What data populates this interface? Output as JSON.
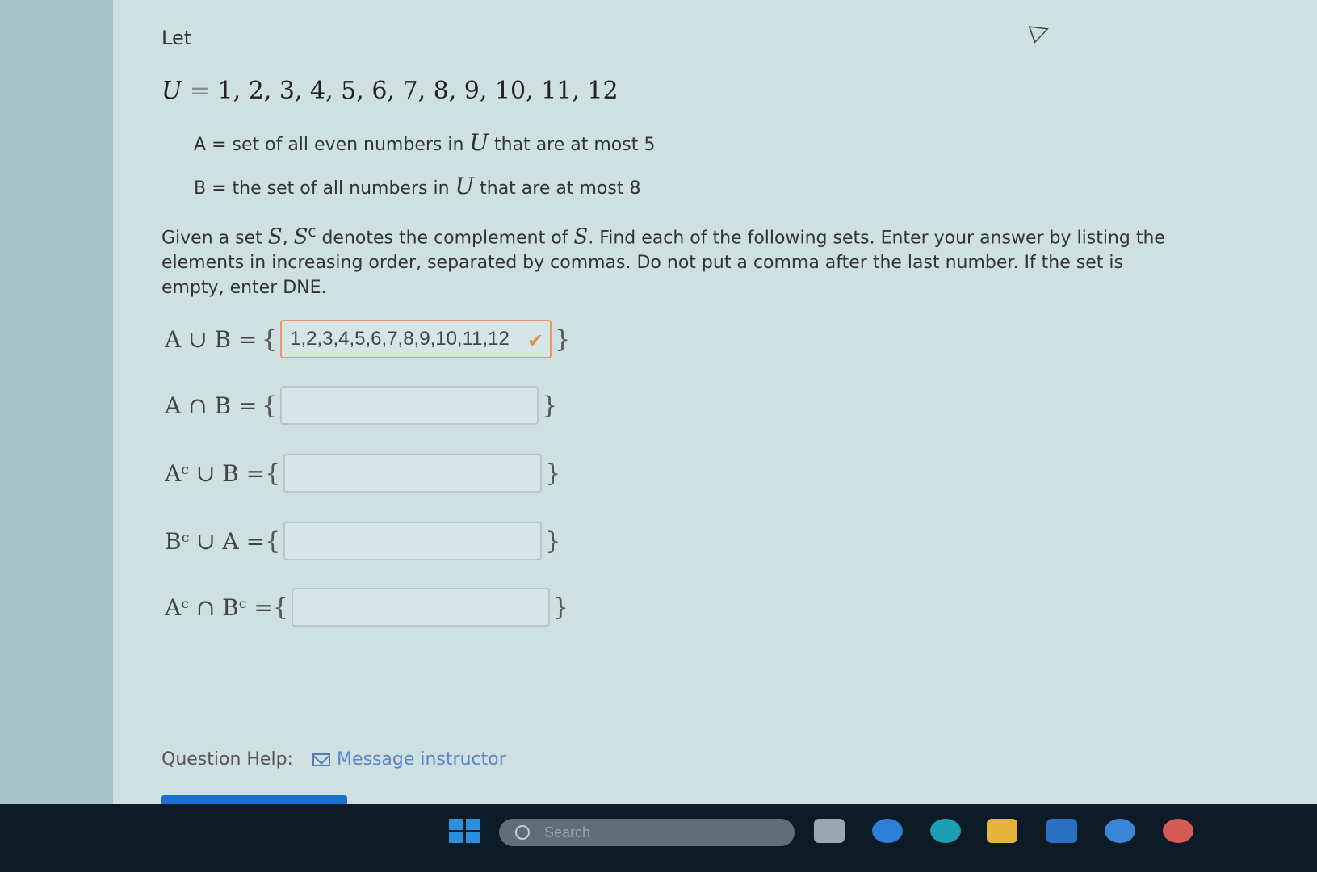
{
  "problem": {
    "intro": "Let",
    "universe": {
      "symbol": "U",
      "equals": "=",
      "elements": "1, 2, 3, 4, 5, 6, 7, 8, 9, 10, 11, 12"
    },
    "set_a": {
      "name": "A",
      "equals": "=",
      "pre": "set of all even numbers in",
      "var": "U",
      "post": "that are at most 5"
    },
    "set_b": {
      "name": "B",
      "equals": "=",
      "pre": "the set of all numbers in",
      "var": "U",
      "post": "that are at most 8"
    },
    "instructions": {
      "p1": "Given a set ",
      "v1": "S",
      "p2": ", ",
      "v2": "S",
      "sup": "c",
      "p3": " denotes the complement of ",
      "v3": "S",
      "p4": ". Find each of the following sets. Enter your answer by listing the elements in increasing order, separated by commas. Do not put a comma after the last number. If the set is empty, enter DNE."
    }
  },
  "rows": [
    {
      "label": "A ∪ B =",
      "open": "{",
      "close": "}",
      "value": "1,2,3,4,5,6,7,8,9,10,11,12",
      "status": "correct",
      "status_icon": "check-icon"
    },
    {
      "label": "A ∩ B =",
      "open": "{",
      "close": "}",
      "value": ""
    },
    {
      "label": "Aᶜ ∪ B =",
      "open": "{",
      "close": "}",
      "value": ""
    },
    {
      "label": "Bᶜ ∪ A =",
      "open": "{",
      "close": "}",
      "value": ""
    },
    {
      "label": "Aᶜ ∩ Bᶜ =",
      "open": "{",
      "close": "}",
      "value": ""
    }
  ],
  "help": {
    "label": "Question Help:",
    "link_icon": "mail-icon",
    "link_text": "Message instructor"
  },
  "taskbar": {
    "search_placeholder": "Search"
  },
  "colors": {
    "accent": "#1a6fd0",
    "link": "#5a84cc",
    "correct_border": "#e29a6a",
    "check": "#e0903e",
    "taskbar": "#0d1b26"
  }
}
